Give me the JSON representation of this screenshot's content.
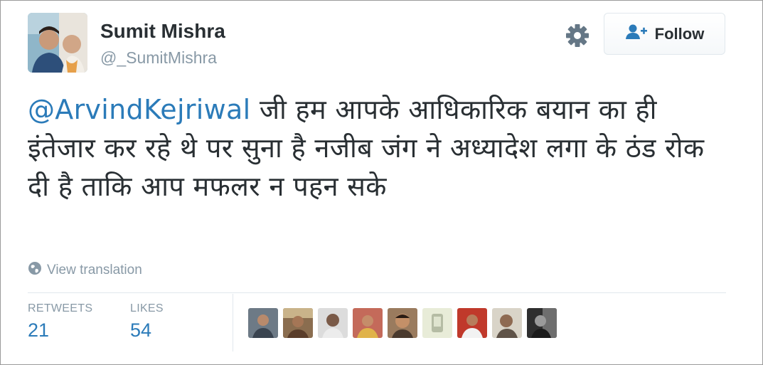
{
  "user": {
    "name": "Sumit Mishra",
    "handle": "@_SumitMishra"
  },
  "follow_button": {
    "label": "Follow"
  },
  "tweet": {
    "mention": "@ArvindKejriwal",
    "text": " जी हम आपके आधिकारिक बयान का ही इंतेजार कर रहे थे पर सुना है नजीब जंग ने अध्यादेश लगा के ठंड रोक दी है ताकि आप मफलर न पहन सके"
  },
  "translation": {
    "label": "View translation",
    "icon": "globe-icon"
  },
  "stats": {
    "retweets_label": "RETWEETS",
    "retweets": "21",
    "likes_label": "LIKES",
    "likes": "54"
  },
  "icons": {
    "settings": "gear-icon",
    "follow": "add-user-icon"
  },
  "colors": {
    "accent": "#2b7bb9",
    "muted": "#8899a6",
    "text": "#292f33",
    "border": "#e1e8ed"
  },
  "likers_count_shown": 9
}
